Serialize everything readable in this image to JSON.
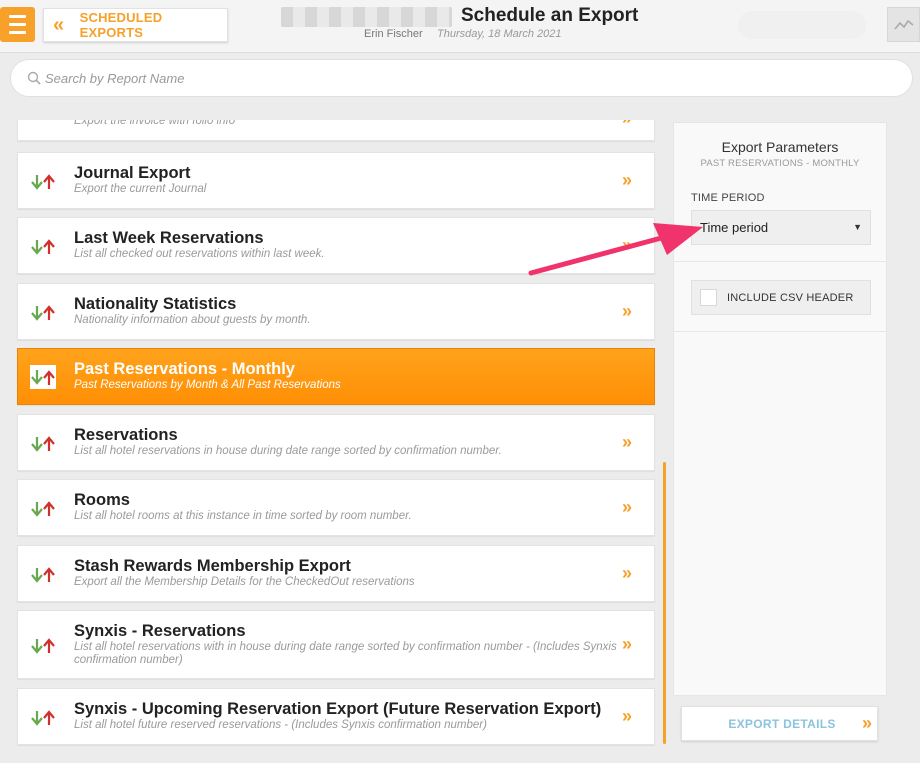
{
  "header": {
    "back_label": "SCHEDULED EXPORTS",
    "title": "Schedule an Export",
    "user": "Erin Fischer",
    "date": "Thursday, 18 March 2021"
  },
  "search": {
    "placeholder": "Search by Report Name"
  },
  "reports": [
    {
      "title": "",
      "desc": "Export the invoice with folio info"
    },
    {
      "title": "Journal Export",
      "desc": "Export the current Journal"
    },
    {
      "title": "Last Week Reservations",
      "desc": "List all checked out reservations within last week."
    },
    {
      "title": "Nationality Statistics",
      "desc": "Nationality information about guests by month."
    },
    {
      "title": "Past Reservations - Monthly",
      "desc": "Past Reservations by Month & All Past Reservations",
      "selected": true
    },
    {
      "title": "Reservations",
      "desc": "List all hotel reservations in house during date range sorted by confirmation number."
    },
    {
      "title": "Rooms",
      "desc": "List all hotel rooms at this instance in time sorted by room number."
    },
    {
      "title": "Stash Rewards Membership Export",
      "desc": "Export all the Membership Details for the CheckedOut reservations"
    },
    {
      "title": "Synxis - Reservations",
      "desc": "List all hotel reservations with in house during date range sorted by confirmation number - (Includes Synxis confirmation number)"
    },
    {
      "title": "Synxis - Upcoming Reservation Export (Future Reservation Export)",
      "desc": "List all hotel future reserved reservations - (Includes Synxis confirmation number)"
    }
  ],
  "params": {
    "title": "Export Parameters",
    "subtitle": "PAST RESERVATIONS - MONTHLY",
    "time_period_label": "TIME PERIOD",
    "time_period_value": "Time period",
    "csv_label": "INCLUDE CSV HEADER",
    "export_label": "EXPORT DETAILS"
  },
  "colors": {
    "accent": "#f7a02a",
    "arrow_down": "#6aa84f",
    "arrow_up": "#d0312d",
    "annotation": "#f1336b"
  },
  "icons": [
    "menu-icon",
    "double-chevron-left-icon",
    "chart-icon",
    "search-icon",
    "sort-arrows-icon",
    "double-chevron-right-icon"
  ]
}
